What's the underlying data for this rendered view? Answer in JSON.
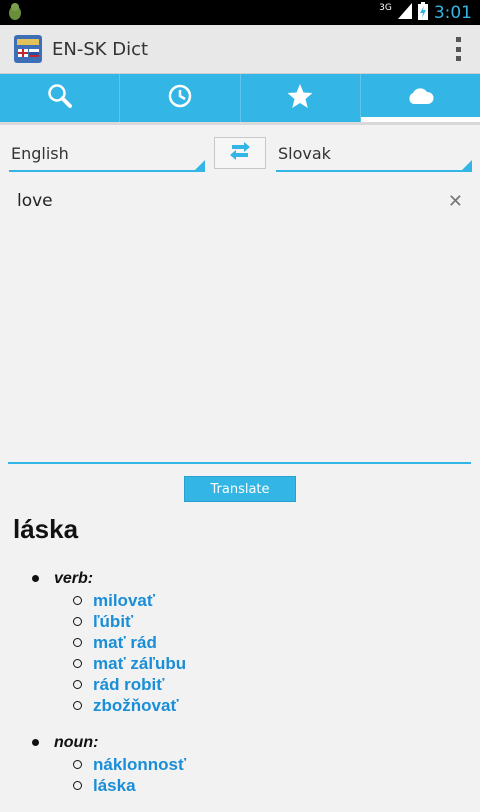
{
  "status_bar": {
    "time": "3:01",
    "network": "3G"
  },
  "app": {
    "title": "EN-SK Dict"
  },
  "tabs": [
    {
      "icon": "search-icon"
    },
    {
      "icon": "history-icon"
    },
    {
      "icon": "star-icon"
    },
    {
      "icon": "cloud-icon",
      "selected": true
    }
  ],
  "languages": {
    "source": "English",
    "target": "Slovak"
  },
  "input": {
    "value": "love"
  },
  "translate_button": {
    "label": "Translate"
  },
  "result": {
    "headword": "láska",
    "parts_of_speech": [
      {
        "label": "verb:",
        "senses": [
          "milovať",
          "ľúbiť",
          "mať rád",
          "mať záľubu",
          "rád robiť",
          "zbožňovať"
        ]
      },
      {
        "label": "noun:",
        "senses": [
          "náklonnosť",
          "láska"
        ]
      }
    ]
  },
  "colors": {
    "accent": "#33b5e5",
    "link": "#1a8ed6"
  }
}
